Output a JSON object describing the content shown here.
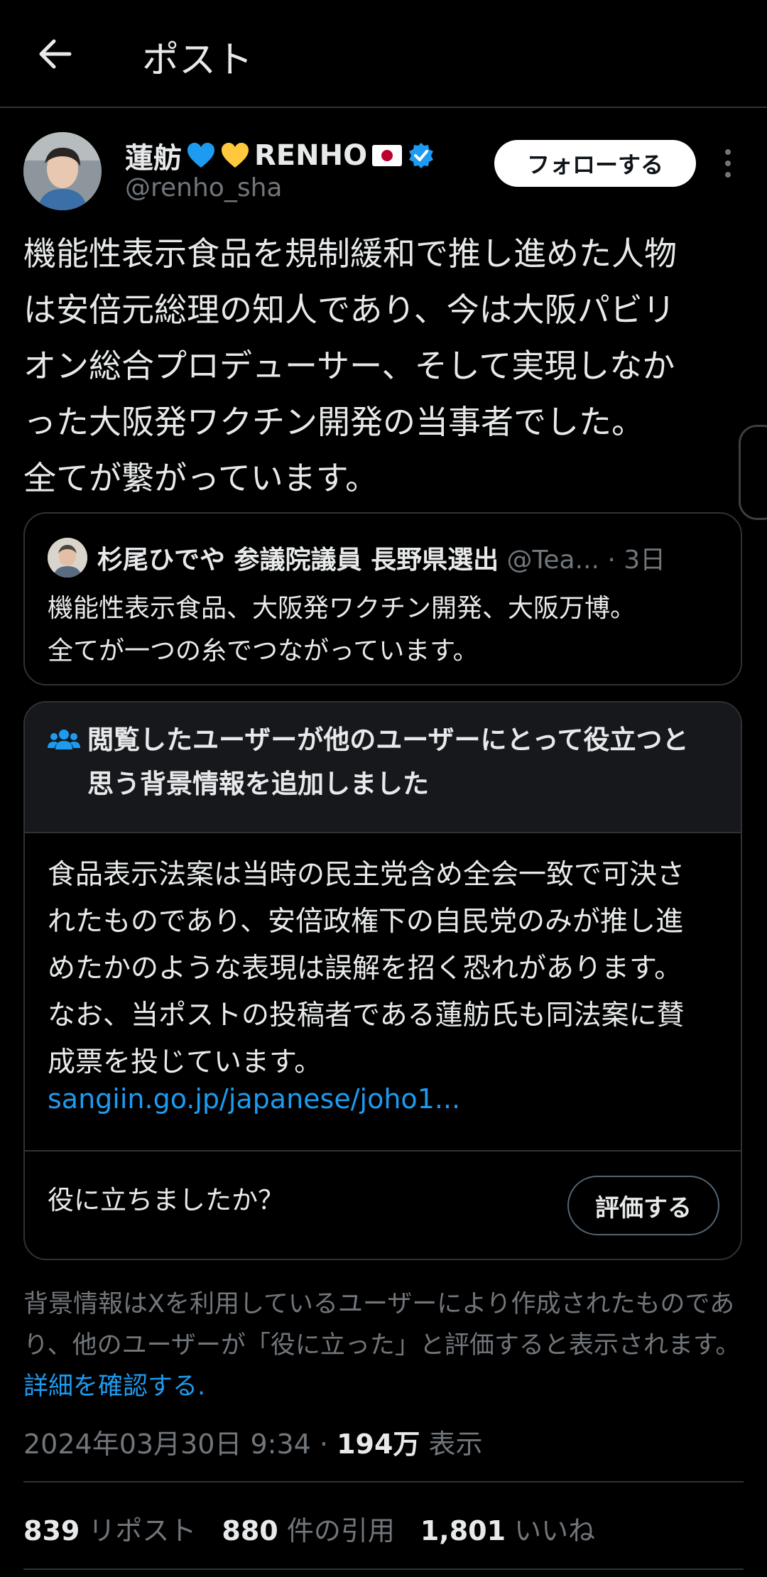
{
  "header": {
    "title": "ポスト"
  },
  "author": {
    "name_prefix": "蓮舫",
    "name_main": "RENHO",
    "handle": "@renho_sha",
    "follow_label": "フォローする"
  },
  "post": {
    "text": "機能性表示食品を規制緩和で推し進めた人物\nは安倍元総理の知人であり、今は大阪パビリ\nオン総合プロデューサー、そして実現しなか\nった大阪発ワクチン開発の当事者でした。\n全てが繋がっています。"
  },
  "quote": {
    "name": "杉尾ひでや 参議院議員 長野県選出",
    "handle": " @Tea...",
    "time": " · 3日",
    "text": "機能性表示食品、大阪発ワクチン開発、大阪万博。\n全てが一つの糸でつながっています。"
  },
  "community_note": {
    "title": "閲覧したユーザーが他のユーザーにとって役立つと\n思う背景情報を追加しました",
    "body": "食品表示法案は当時の民主党含め全会一致で可決さ\nれたものであり、安倍政権下の自民党のみが推し進\nめたかのような表現は誤解を招く恐れがあります。\nなお、当ポストの投稿者である蓮舫氏も同法案に賛\n成票を投じています。",
    "link": "sangiin.go.jp/japanese/joho1...",
    "helpful_question": "役に立ちましたか？",
    "rate_label": "評価する"
  },
  "disclaimer": {
    "text": "背景情報はXを利用しているユーザーにより作成されたものであり、他のユーザーが「役に立った」と評価すると表示されます。 ",
    "link": "詳細を確認する."
  },
  "meta": {
    "timestamp": "2024年03月30日 9:34 · ",
    "views_count": "194万",
    "views_label": " 表示"
  },
  "stats": {
    "reposts_count": "839",
    "reposts_label": " リポスト",
    "quotes_count": "880",
    "quotes_label": " 件の引用",
    "likes_count": "1,801",
    "likes_label": " いいね"
  },
  "colors": {
    "accent": "#1d9bf0",
    "background": "#000000",
    "secondary_text": "#71767b",
    "blue_heart": "#1d9bf0",
    "yellow_heart": "#ffc83d"
  }
}
